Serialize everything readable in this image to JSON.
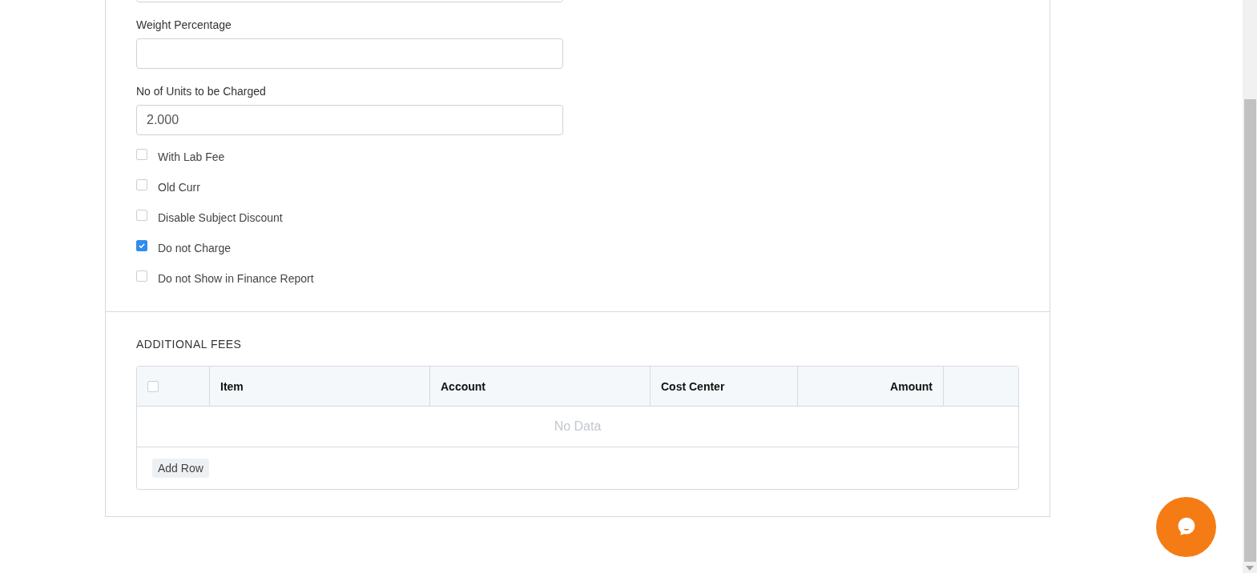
{
  "fields": [
    {
      "label": "Weight Percentage"
    },
    {
      "label": "No of Units to be Charged",
      "value": "2.000"
    }
  ],
  "options": [
    {
      "label": "With Lab Fee",
      "checked": false
    },
    {
      "label": "Old Curr",
      "checked": false
    },
    {
      "label": "Disable Subject Discount",
      "checked": false
    },
    {
      "label": "Do not Charge",
      "checked": true
    },
    {
      "label": "Do not Show in Finance Report",
      "checked": false
    }
  ],
  "additional_fees": {
    "title": "ADDITIONAL FEES",
    "select_all_checked": false,
    "columns": [
      {
        "label": "Item",
        "kind": "text"
      },
      {
        "label": "Account",
        "kind": "text"
      },
      {
        "label": "Cost Center",
        "kind": "text"
      },
      {
        "label": "Amount",
        "kind": "number"
      }
    ],
    "empty_text": "No Data",
    "add_button": "Add Row"
  }
}
